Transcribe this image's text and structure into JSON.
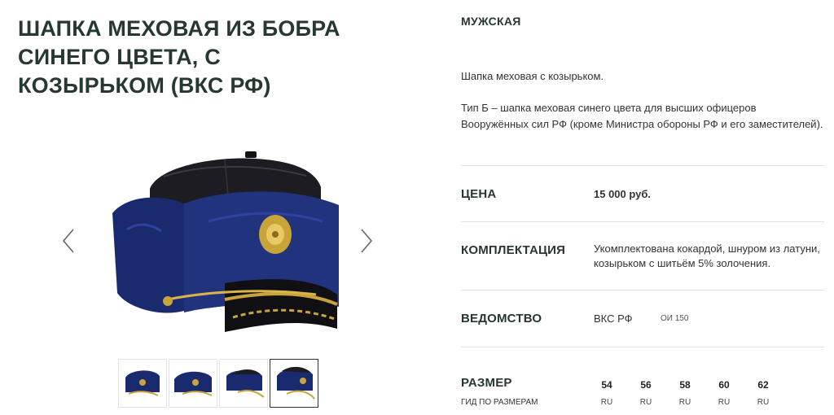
{
  "product": {
    "title": "ШАПКА МЕХОВАЯ ИЗ БОБРА СИНЕГО ЦВЕТА, С КОЗЫРЬКОМ (ВКС РФ)"
  },
  "gallery": {
    "prev_icon": "chevron-left-icon",
    "next_icon": "chevron-right-icon",
    "thumb_count": 4,
    "active_index": 3
  },
  "details": {
    "category": "МУЖСКАЯ",
    "description_short": "Шапка меховая с козырьком.",
    "description_long": "Тип Б – шапка меховая синего цвета для высших офицеров Вооружённых сил РФ (кроме Министра обороны РФ и его заместителей).",
    "price_label": "ЦЕНА",
    "price_value": "15 000 руб.",
    "kit_label": "КОМПЛЕКТАЦИЯ",
    "kit_value": "Укомплектована кокардой, шнуром из латуни, козырьком с шитьём 5% золочения.",
    "dept_label": "ВЕДОМСТВО",
    "dept_value": "ВКС РФ",
    "dept_code": "ОИ 150",
    "size_label": "РАЗМЕР",
    "size_guide": "ГИД ПО РАЗМЕРАМ",
    "sizes": [
      {
        "n": "54",
        "u": "RU"
      },
      {
        "n": "56",
        "u": "RU"
      },
      {
        "n": "58",
        "u": "RU"
      },
      {
        "n": "60",
        "u": "RU"
      },
      {
        "n": "62",
        "u": "RU"
      }
    ]
  },
  "colors": {
    "heading": "#26382f",
    "fur": "#1a2a6e",
    "leather": "#1c1c22",
    "gold": "#c9a43a"
  }
}
